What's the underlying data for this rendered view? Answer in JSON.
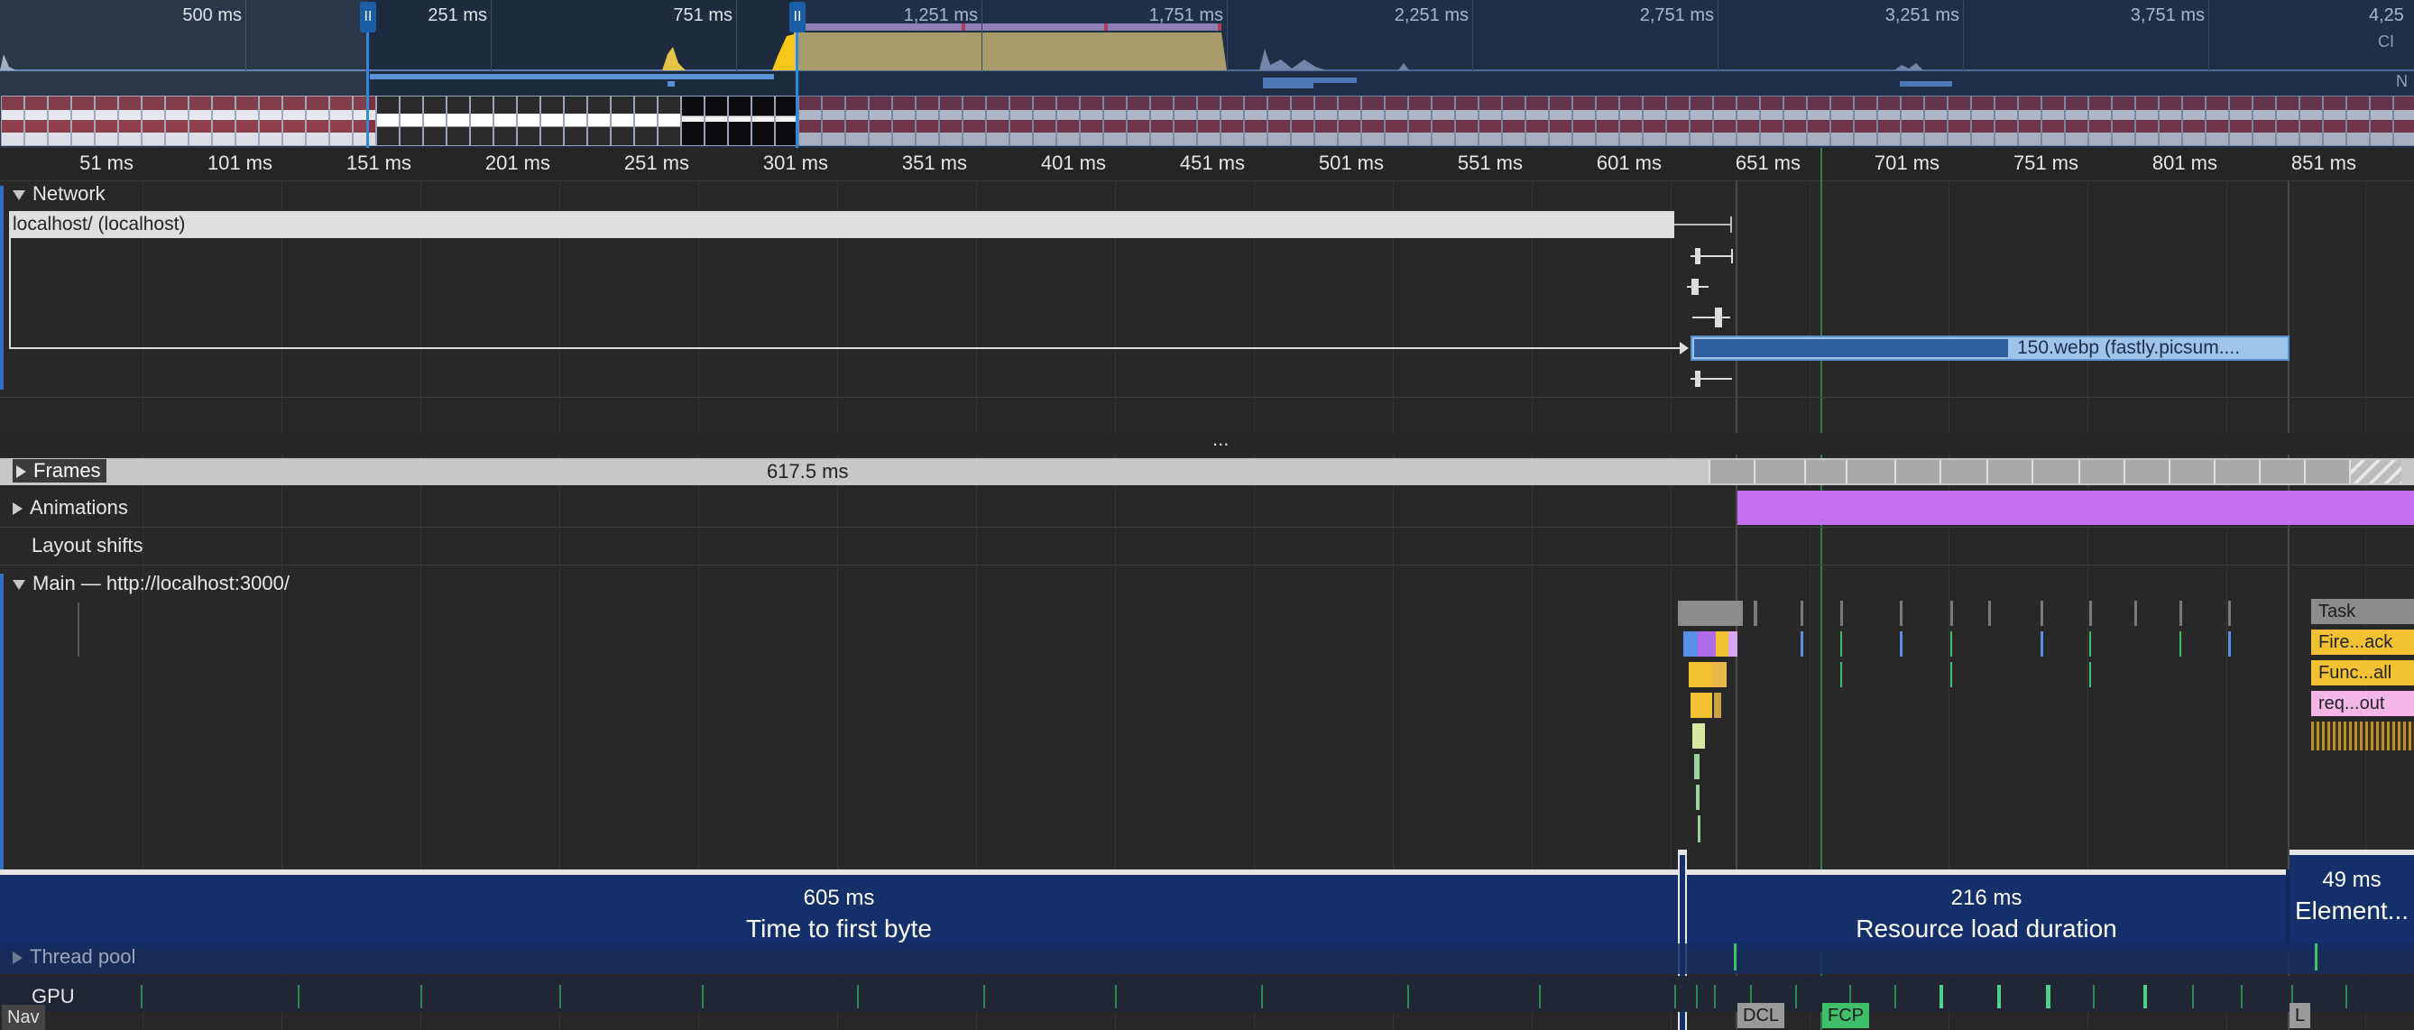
{
  "overview": {
    "ticks": [
      "500 ms",
      "251 ms",
      "751 ms",
      "1,251 ms",
      "1,751 ms",
      "2,251 ms",
      "2,751 ms",
      "3,251 ms",
      "3,751 ms",
      "4,25"
    ],
    "right_labels": [
      "CI",
      "N"
    ],
    "handle_glyph": "II"
  },
  "ruler": {
    "ticks": [
      "51 ms",
      "101 ms",
      "151 ms",
      "201 ms",
      "251 ms",
      "301 ms",
      "351 ms",
      "401 ms",
      "451 ms",
      "501 ms",
      "551 ms",
      "601 ms",
      "651 ms",
      "701 ms",
      "751 ms",
      "801 ms",
      "851 ms"
    ]
  },
  "tracks": {
    "network": {
      "label": "Network",
      "main_request": "localhost/ (localhost)",
      "image_request": "150.webp (fastly.picsum...."
    },
    "collapse_handle": "...",
    "frames": {
      "label": "Frames",
      "duration": "617.5 ms"
    },
    "animations": {
      "label": "Animations"
    },
    "layout_shifts": {
      "label": "Layout shifts"
    },
    "main": {
      "label": "Main — http://localhost:3000/",
      "entries": [
        "Task",
        "Fire...ack",
        "Func...all",
        "req...out"
      ]
    },
    "thread_pool": {
      "label": "Thread pool"
    },
    "gpu": {
      "label": "GPU"
    }
  },
  "insights": [
    {
      "value": "605 ms",
      "title": "Time to first byte"
    },
    {
      "value": "216 ms",
      "title": "Resource load duration"
    },
    {
      "value": "49 ms",
      "title": "Element..."
    }
  ],
  "markers": {
    "nav": "Nav",
    "dcl": "DCL",
    "fcp": "FCP",
    "lcp": "L"
  },
  "colors": {
    "animation": "#c46ff0",
    "task": "#8b8b8b",
    "script": "#f2c232",
    "request": "#9ec4ea",
    "insight_band": "#13306a",
    "fcp": "#3fbf6a"
  }
}
